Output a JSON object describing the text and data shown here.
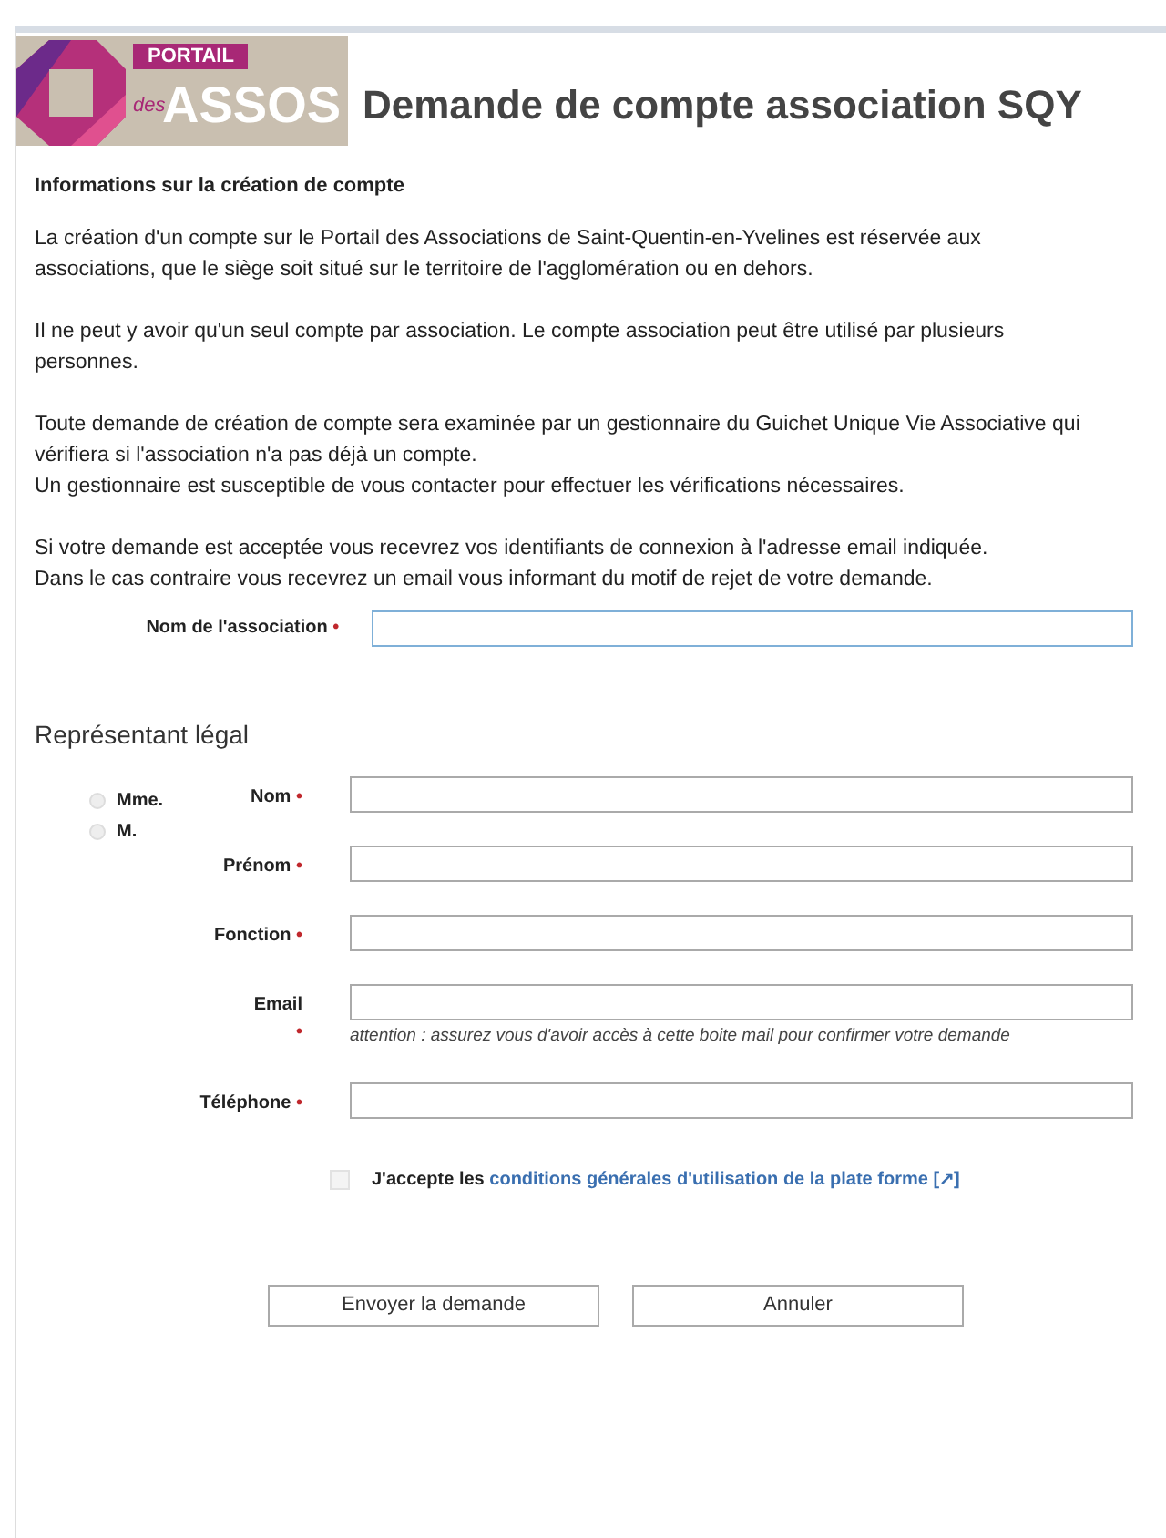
{
  "header": {
    "logo_top": "PORTAIL",
    "logo_small": "des",
    "logo_main": "ASSOS",
    "title": "Demande de compte association SQY"
  },
  "info": {
    "heading": "Informations sur la création de compte",
    "paragraphs": [
      "La création d'un compte sur le Portail des Associations de Saint-Quentin-en-Yvelines est réservée aux associations, que le siège soit situé sur le territoire de l'agglomération ou en dehors.",
      "Il ne peut y avoir qu'un seul compte par association. Le compte association peut être utilisé par plusieurs personnes.",
      "Toute demande de création de compte sera examinée par un gestionnaire du Guichet Unique Vie Associative qui vérifiera si l'association n'a pas déjà un compte.\nUn gestionnaire est susceptible de vous contacter pour effectuer les vérifications nécessaires.",
      "Si votre demande est acceptée vous recevrez vos identifiants de connexion à l'adresse email indiquée.\nDans le cas contraire vous recevrez un email vous informant du motif de rejet de votre demande."
    ]
  },
  "association_field": {
    "label": "Nom de l'association",
    "required_mark": "•",
    "focused": true
  },
  "section_title": "Représentant légal",
  "civility": [
    {
      "label": "Mme.",
      "selected": false
    },
    {
      "label": "M.",
      "selected": false
    }
  ],
  "fields": [
    {
      "label": "Nom",
      "required_mark": "•"
    },
    {
      "label": "Prénom",
      "required_mark": "•"
    },
    {
      "label": "Fonction",
      "required_mark": "•"
    },
    {
      "label": "Email",
      "required_mark": "•",
      "note": "attention : assurez vous d'avoir accès à cette boite mail pour confirmer votre demande"
    },
    {
      "label": "Téléphone",
      "required_mark": "•"
    }
  ],
  "terms": {
    "checked": false,
    "text": "J'accepte les",
    "link": "conditions générales d'utilisation de la plate forme [↗]"
  },
  "buttons": [
    "Envoyer la demande",
    "Annuler"
  ]
}
